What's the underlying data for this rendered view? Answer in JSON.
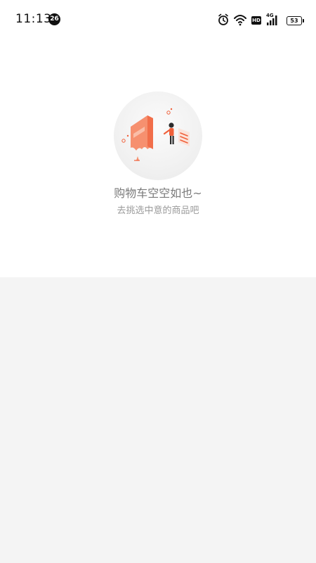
{
  "status_bar": {
    "time": "11:13",
    "notification_count": "26",
    "hd_label": "HD",
    "network_label": "4G",
    "battery_level": "53"
  },
  "empty_cart": {
    "title": "购物车空空如也~",
    "subtitle": "去挑选中意的商品吧",
    "illustration_icon": "empty-cart-illustration",
    "accent_color": "#f0603a"
  }
}
